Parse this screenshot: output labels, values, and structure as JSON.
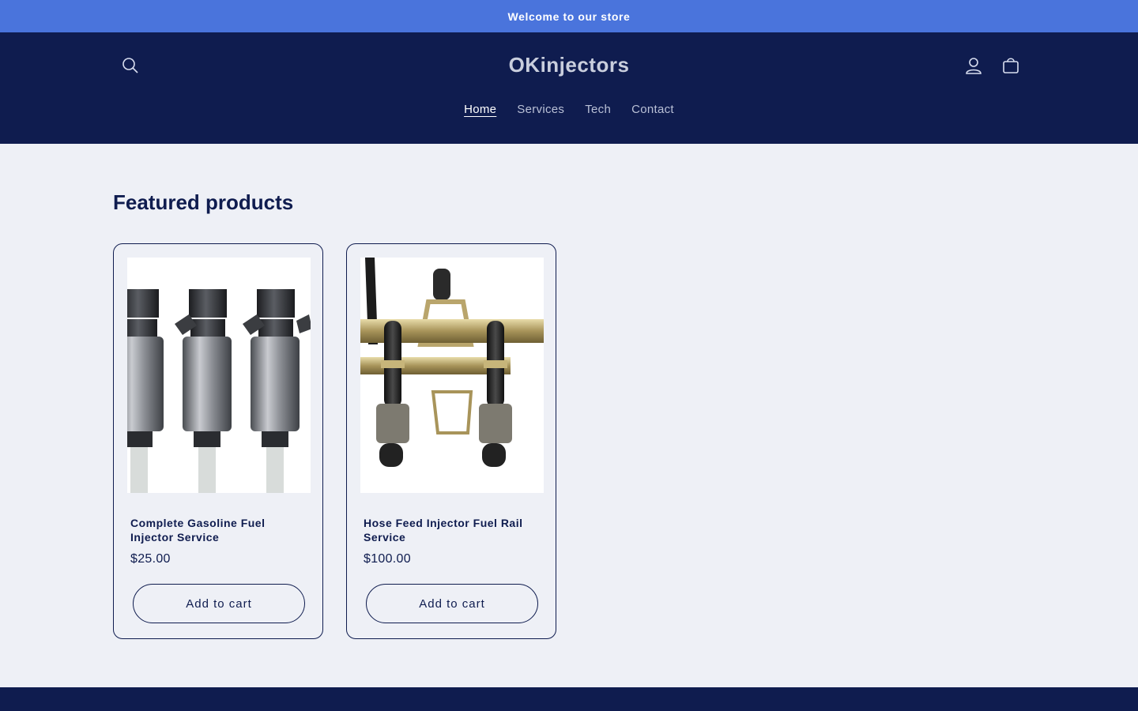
{
  "announcement": {
    "text": "Welcome to our store"
  },
  "header": {
    "logo": "OKinjectors",
    "icons": {
      "search": "search-icon",
      "account": "user-icon",
      "cart": "bag-icon"
    },
    "nav": [
      {
        "label": "Home",
        "active": true
      },
      {
        "label": "Services",
        "active": false
      },
      {
        "label": "Tech",
        "active": false
      },
      {
        "label": "Contact",
        "active": false
      }
    ]
  },
  "featured": {
    "title": "Featured products",
    "products": [
      {
        "title": "Complete Gasoline Fuel Injector Service",
        "price": "$25.00",
        "button": "Add to cart",
        "image": "fuel-injectors-photo"
      },
      {
        "title": "Hose Feed Injector Fuel Rail Service",
        "price": "$100.00",
        "button": "Add to cart",
        "image": "fuel-rail-photo"
      }
    ]
  },
  "colors": {
    "announcement_bg": "#4a74dc",
    "header_bg": "#0f1c4f",
    "page_bg": "#eef0f6",
    "accent": "#0f1c4f"
  }
}
